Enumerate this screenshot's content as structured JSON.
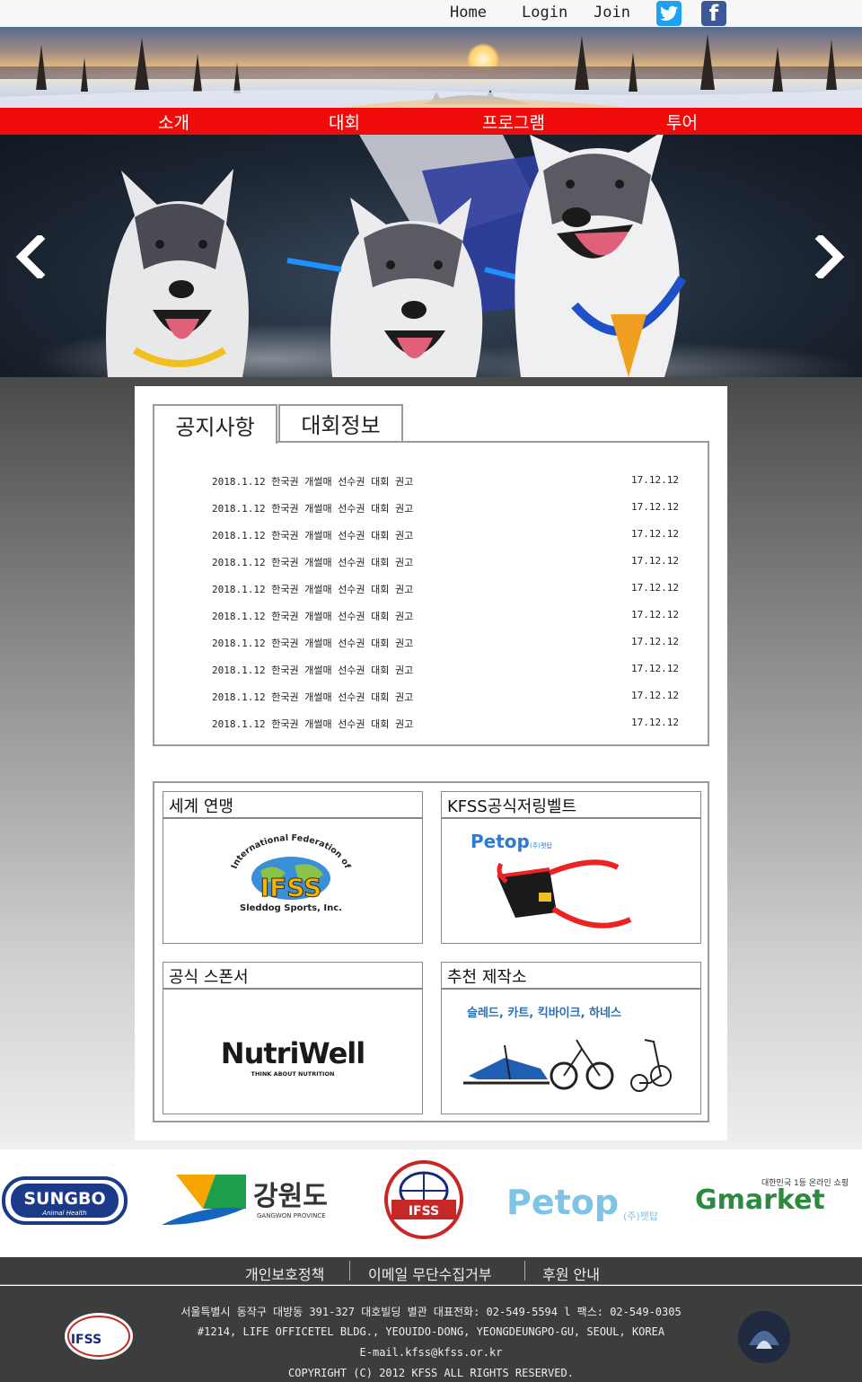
{
  "top_nav": {
    "home": "Home",
    "login": "Login",
    "join": "Join"
  },
  "social": {
    "twitter_icon": "twitter-icon",
    "facebook_icon": "facebook-icon",
    "facebook_glyph": "f"
  },
  "main_menu": [
    "소개",
    "대회",
    "프로그램",
    "투어"
  ],
  "colors": {
    "menu_red": "#f10c0c",
    "footer": "#3d3d3d",
    "twitter": "#1da1f2",
    "facebook": "#3b5998"
  },
  "tabs": {
    "notice": "공지사항",
    "event_info": "대회정보"
  },
  "notices": [
    {
      "title": "2018.1.12 한국권 개썰매 선수권 대회 권고",
      "date": "17.12.12"
    },
    {
      "title": "2018.1.12 한국권 개썰매 선수권 대회 권고",
      "date": "17.12.12"
    },
    {
      "title": "2018.1.12 한국권 개썰매 선수권 대회 권고",
      "date": "17.12.12"
    },
    {
      "title": "2018.1.12 한국권 개썰매 선수권 대회 권고",
      "date": "17.12.12"
    },
    {
      "title": "2018.1.12 한국권 개썰매 선수권 대회 권고",
      "date": "17.12.12"
    },
    {
      "title": "2018.1.12 한국권 개썰매 선수권 대회 권고",
      "date": "17.12.12"
    },
    {
      "title": "2018.1.12 한국권 개썰매 선수권 대회 권고",
      "date": "17.12.12"
    },
    {
      "title": "2018.1.12 한국권 개썰매 선수권 대회 권고",
      "date": "17.12.12"
    },
    {
      "title": "2018.1.12 한국권 개썰매 선수권 대회 권고",
      "date": "17.12.12"
    },
    {
      "title": "2018.1.12 한국권 개썰매 선수권 대회 권고",
      "date": "17.12.12"
    }
  ],
  "cards": {
    "world": {
      "heading": "세계 연맹",
      "arc_text": "International Federation of",
      "logo_text": "IFSS",
      "sub_text": "Sleddog Sports, Inc."
    },
    "belt": {
      "heading": "KFSS공식저링벨트",
      "brand": "Petop",
      "brand_sub": "(주)펫탑"
    },
    "sponsor": {
      "heading": "공식 스폰서",
      "brand": "NutriWell",
      "tagline": "THINK ABOUT NUTRITION"
    },
    "maker": {
      "heading": "추천 제작소",
      "products": "슬레드, 카트, 킥바이크, 하네스"
    }
  },
  "sponsor_strip": {
    "sungbo": "SUNGBO",
    "sungbo_sub": "Animal Health",
    "gangwon": "강원도",
    "gangwon_sub": "GANGWON PROVINCE",
    "ifss": "IFSS",
    "petop": "Petop",
    "petop_sub": "(주)펫탑",
    "gmarket": "Gmarket",
    "gmarket_tag": "대한민국 1등 온라인 쇼핑"
  },
  "footer_links": [
    "개인보호정책",
    "이메일 무단수집거부",
    "후원 안내"
  ],
  "footer": {
    "address_kr": "서울특별시 동작구 대방동 391-327 대호빌딩 별관 대표전화: 02-549-5594 l 팩스: 02-549-0305",
    "address_en": "#1214, LIFE OFFICETEL BLDG., YEOUIDO-DONG, YEONGDEUNGPO-GU, SEOUL, KOREA",
    "email": "E-mail.kfss@kfss.or.kr",
    "copyright": "COPYRIGHT (C) 2012 KFSS ALL RIGHTS RESERVED.",
    "left_logo": "IFSS"
  }
}
